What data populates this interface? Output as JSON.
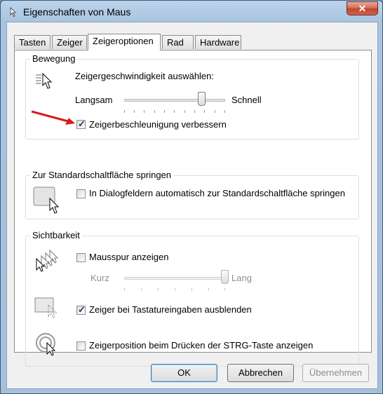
{
  "window": {
    "title": "Eigenschaften von Maus",
    "close_symbol": "✕"
  },
  "tabs": [
    {
      "label": "Tasten"
    },
    {
      "label": "Zeiger"
    },
    {
      "label": "Zeigeroptionen",
      "active": true
    },
    {
      "label": "Rad"
    },
    {
      "label": "Hardware"
    }
  ],
  "bewegung": {
    "title": "Bewegung",
    "speed_label": "Zeigergeschwindigkeit auswählen:",
    "slow": "Langsam",
    "fast": "Schnell",
    "speed_value": 0.77,
    "accel_label": "Zeigerbeschleunigung verbessern",
    "accel_checked": true
  },
  "snap": {
    "title": "Zur Standardschaltfläche springen",
    "label": "In Dialogfeldern automatisch zur Standardschaltfläche springen",
    "checked": false
  },
  "sichtbarkeit": {
    "title": "Sichtbarkeit",
    "trail_label": "Mausspur anzeigen",
    "trail_checked": false,
    "short": "Kurz",
    "long": "Lang",
    "trail_value": 1.0,
    "hide_label": "Zeiger bei Tastatureingaben ausblenden",
    "hide_checked": true,
    "ctrl_label": "Zeigerposition beim Drücken der STRG-Taste anzeigen",
    "ctrl_checked": false
  },
  "buttons": {
    "ok": "OK",
    "cancel": "Abbrechen",
    "apply": "Übernehmen"
  },
  "annotation": {
    "arrow_color": "#d81d1d"
  }
}
